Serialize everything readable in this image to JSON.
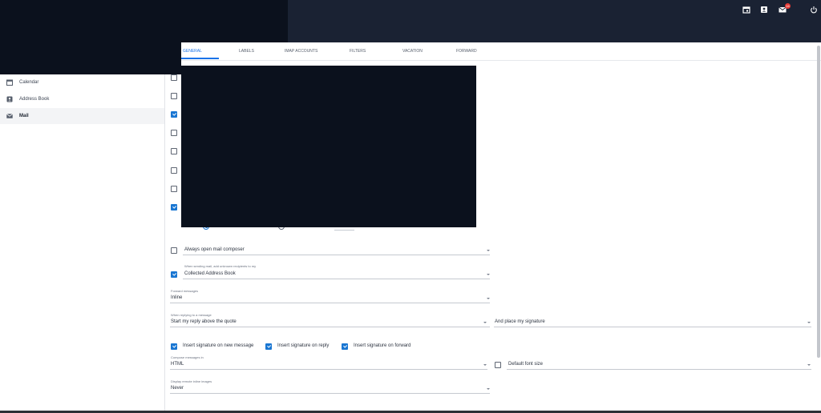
{
  "header": {
    "icons": [
      {
        "name": "calendar-icon"
      },
      {
        "name": "contacts-icon"
      },
      {
        "name": "mail-icon",
        "badge": "16"
      },
      {
        "name": "power-icon"
      }
    ]
  },
  "sidebar": {
    "items": [
      {
        "label": "Calendar",
        "icon": "calendar-icon",
        "active": false
      },
      {
        "label": "Address Book",
        "icon": "contacts-icon",
        "active": false
      },
      {
        "label": "Mail",
        "icon": "mail-icon",
        "active": true
      }
    ]
  },
  "tabs": [
    {
      "label": "GENERAL",
      "active": true
    },
    {
      "label": "LABELS",
      "active": false
    },
    {
      "label": "IMAP ACCOUNTS",
      "active": false
    },
    {
      "label": "FILTERS",
      "active": false
    },
    {
      "label": "VACATION",
      "active": false
    },
    {
      "label": "FORWARD",
      "active": false
    }
  ],
  "general": {
    "always_open_composer": {
      "label": "Always open mail composer",
      "checked": false
    },
    "collected": {
      "small_label": "When sending mail, add unknown recipients to my",
      "value": "Collected Address Book",
      "checked": true
    },
    "forward_messages": {
      "label": "Forward messages",
      "value": "Inline"
    },
    "reply": {
      "label": "When replying to a message",
      "value": "Start my reply above the quote",
      "signature_value": "And place my signature"
    },
    "sig_new": {
      "label": "Insert signature on new message",
      "checked": true
    },
    "sig_reply": {
      "label": "Insert signature on reply",
      "checked": true
    },
    "sig_forward": {
      "label": "Insert signature on forward",
      "checked": true
    },
    "compose": {
      "label": "Compose messages in",
      "value": "HTML"
    },
    "default_font": {
      "label": "Default font size",
      "checked": false
    },
    "remote_images": {
      "label": "Display remote inline images",
      "value": "Never"
    }
  }
}
